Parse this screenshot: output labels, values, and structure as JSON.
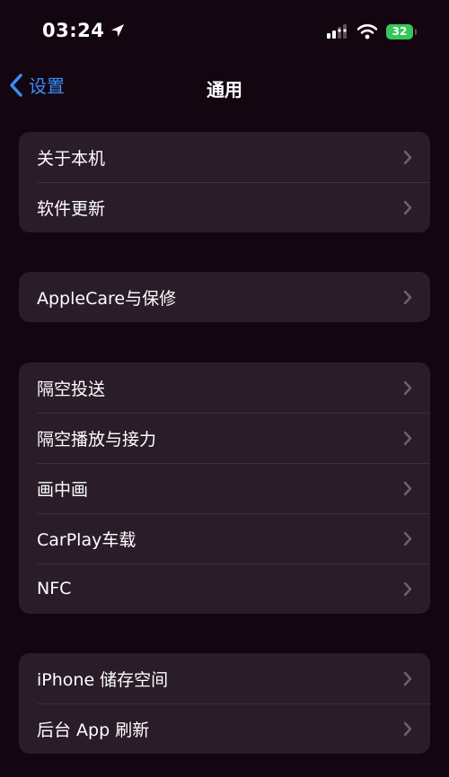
{
  "status_bar": {
    "time": "03:24",
    "battery_level": "32"
  },
  "nav": {
    "back_label": "设置",
    "title": "通用"
  },
  "groups": [
    {
      "items": [
        {
          "label": "关于本机"
        },
        {
          "label": "软件更新"
        }
      ]
    },
    {
      "items": [
        {
          "label": "AppleCare与保修"
        }
      ]
    },
    {
      "items": [
        {
          "label": "隔空投送"
        },
        {
          "label": "隔空播放与接力"
        },
        {
          "label": "画中画"
        },
        {
          "label": "CarPlay车载"
        },
        {
          "label": "NFC"
        }
      ]
    },
    {
      "items": [
        {
          "label": "iPhone 储存空间"
        },
        {
          "label": "后台 App 刷新"
        }
      ]
    }
  ],
  "colors": {
    "background": "#140611",
    "cell_background": "#2a1c29",
    "accent": "#3a8cf7",
    "battery": "#34c759"
  }
}
